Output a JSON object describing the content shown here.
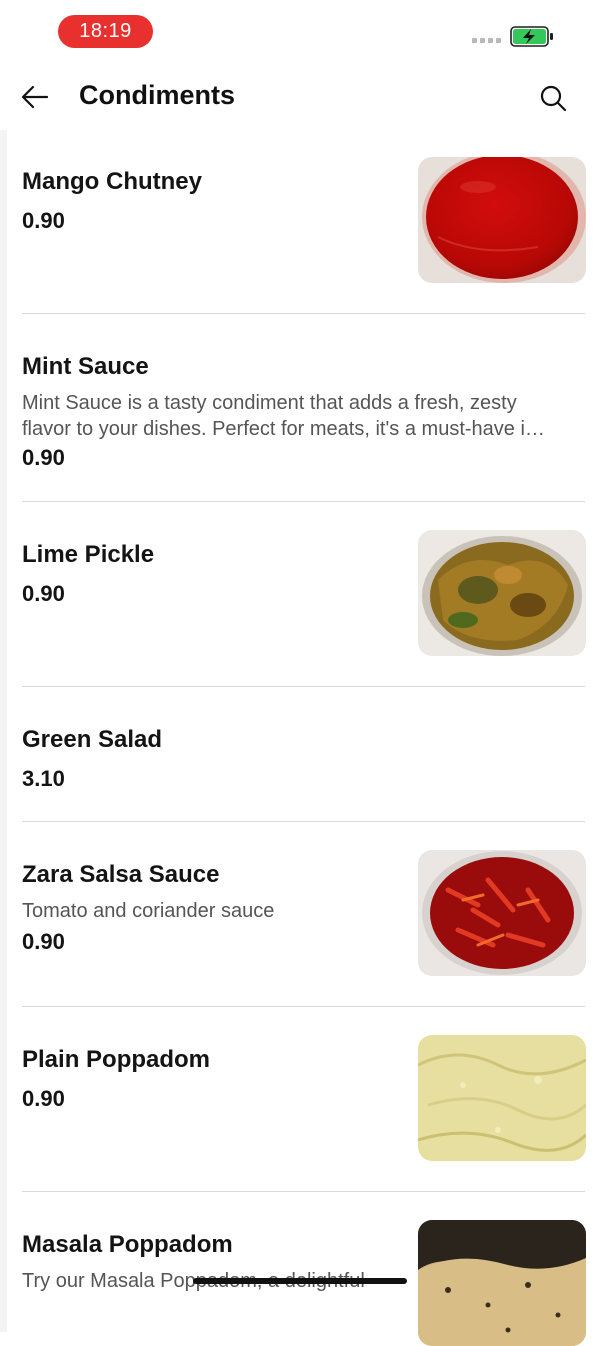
{
  "status_bar": {
    "time": "18:19",
    "time_pill_color": "#e8312f",
    "battery_icon": "battery-charging-icon",
    "battery_color": "#34c759"
  },
  "header": {
    "title": "Condiments",
    "back_icon": "arrow-left-icon",
    "search_icon": "search-icon"
  },
  "items": [
    {
      "name": "Mango Chutney",
      "description": "",
      "price": "0.90",
      "has_image": true
    },
    {
      "name": "Mint Sauce",
      "description_lines": [
        "Mint Sauce is a tasty condiment that adds a fresh, zesty",
        "flavor to your dishes. Perfect for meats, it's a must-have i…"
      ],
      "price": "0.90",
      "has_image": false
    },
    {
      "name": "Lime Pickle",
      "description": "",
      "price": "0.90",
      "has_image": true
    },
    {
      "name": "Green Salad",
      "description": "",
      "price": "3.10",
      "has_image": false
    },
    {
      "name": "Zara Salsa Sauce",
      "description": "Tomato and coriander sauce",
      "price": "0.90",
      "has_image": true
    },
    {
      "name": "Plain Poppadom",
      "description": "",
      "price": "0.90",
      "has_image": true
    },
    {
      "name": "Masala Poppadom",
      "description": "Try our Masala Poppadom, a delightful",
      "price": "",
      "has_image": true
    }
  ]
}
